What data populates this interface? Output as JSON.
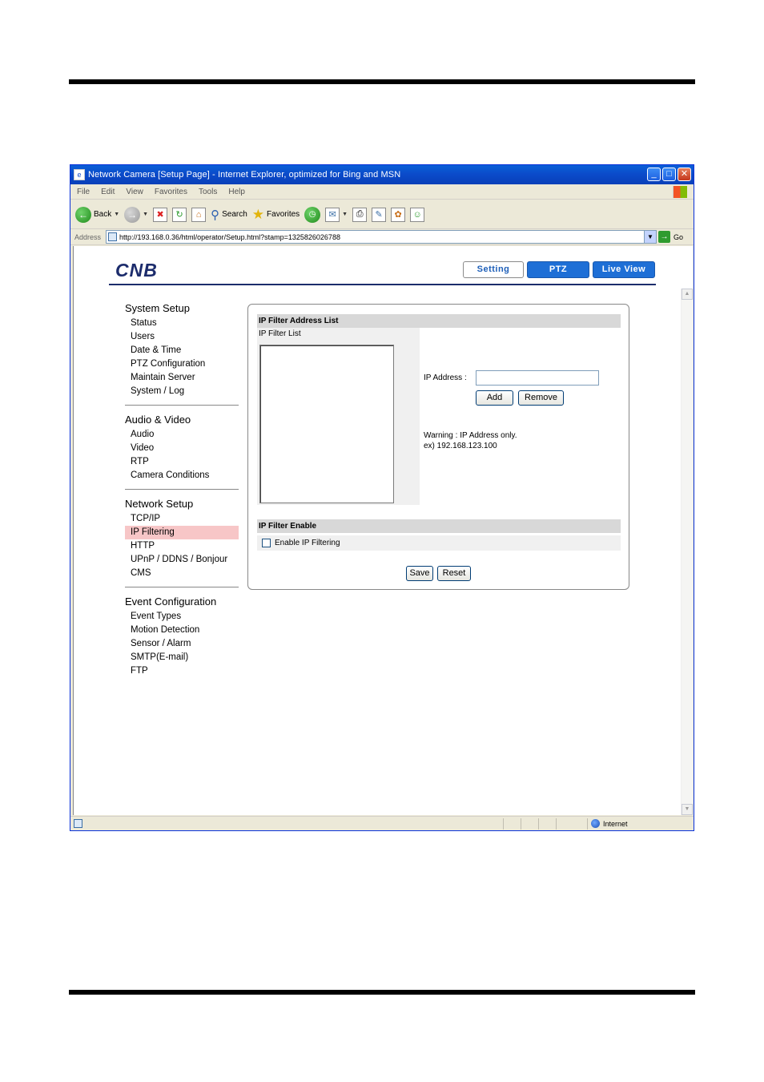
{
  "window": {
    "title": "Network Camera [Setup Page] - Internet Explorer, optimized for Bing and MSN",
    "minimize": "_",
    "maximize": "□",
    "close": "✕"
  },
  "menu": [
    "File",
    "Edit",
    "View",
    "Favorites",
    "Tools",
    "Help"
  ],
  "toolbar": {
    "back": "Back",
    "search": "Search",
    "favorites": "Favorites"
  },
  "address": {
    "label": "Address",
    "url": "http://193.168.0.36/html/operator/Setup.html?stamp=1325826026788",
    "go": "Go"
  },
  "header": {
    "logo": "CNB",
    "nav": {
      "setting": "Setting",
      "ptz": "PTZ",
      "live": "Live View"
    }
  },
  "sidebar": {
    "groups": [
      {
        "title": "System Setup",
        "items": [
          "Status",
          "Users",
          "Date & Time",
          "PTZ Configuration",
          "Maintain Server",
          "System / Log"
        ]
      },
      {
        "title": "Audio & Video",
        "items": [
          "Audio",
          "Video",
          "RTP",
          "Camera Conditions"
        ]
      },
      {
        "title": "Network Setup",
        "items": [
          "TCP/IP",
          "IP Filtering",
          "HTTP",
          "UPnP / DDNS / Bonjour",
          "CMS"
        ]
      },
      {
        "title": "Event Configuration",
        "items": [
          "Event Types",
          "Motion Detection",
          "Sensor / Alarm",
          "SMTP(E-mail)",
          "FTP"
        ]
      }
    ]
  },
  "panel": {
    "list_section": "IP Filter Address List",
    "list_label": "IP Filter List",
    "ip_label": "IP Address :",
    "ip_value": "",
    "add": "Add",
    "remove": "Remove",
    "warning1": "Warning : IP Address only.",
    "warning2": "ex) 192.168.123.100",
    "enable_section": "IP Filter Enable",
    "enable_label": "Enable IP Filtering",
    "save": "Save",
    "reset": "Reset"
  },
  "status": {
    "zone": "Internet"
  }
}
